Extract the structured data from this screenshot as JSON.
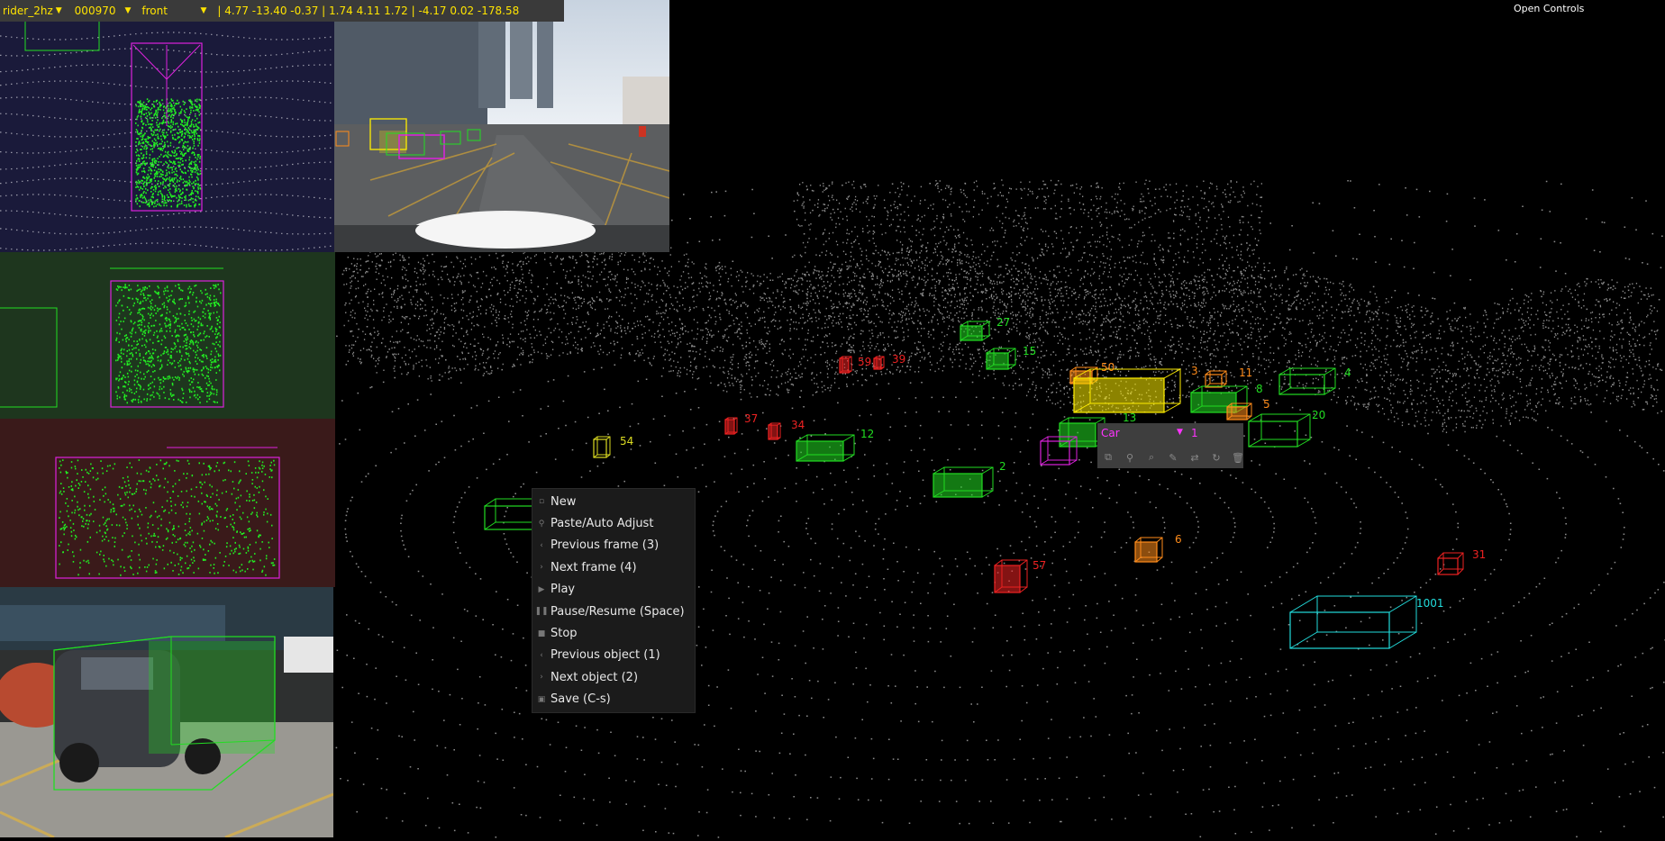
{
  "header": {
    "scene": "rider_2hz",
    "frame": "000970",
    "camera": "front",
    "position": "4.77 -13.40 -0.37",
    "scale": "1.74 4.11 1.72",
    "rotation": "-4.17 0.02 -178.58"
  },
  "open_controls": "Open Controls",
  "context_menu": [
    {
      "label": "New",
      "icon": "new-icon"
    },
    {
      "label": "Paste/Auto Adjust",
      "icon": "paste-icon"
    },
    {
      "label": "Previous frame (3)",
      "icon": "chevron-left-icon"
    },
    {
      "label": "Next frame (4)",
      "icon": "chevron-right-icon"
    },
    {
      "label": "Play",
      "icon": "play-icon"
    },
    {
      "label": "Pause/Resume (Space)",
      "icon": "pause-icon"
    },
    {
      "label": "Stop",
      "icon": "stop-icon"
    },
    {
      "label": "Previous object (1)",
      "icon": "chevron-left-icon"
    },
    {
      "label": "Next object (2)",
      "icon": "chevron-right-icon"
    },
    {
      "label": "Save (C-s)",
      "icon": "save-icon"
    }
  ],
  "object_toolbar": {
    "class": "Car",
    "id": "1",
    "tools": [
      "copy-icon",
      "pin-icon",
      "zoom-icon",
      "edit-icon",
      "swap-icon",
      "sync-icon",
      "delete-icon"
    ]
  },
  "labels": [
    {
      "text": "27",
      "color": "#22dd22"
    },
    {
      "text": "15",
      "color": "#22dd22"
    },
    {
      "text": "50",
      "color": "#ff8c1a"
    },
    {
      "text": "3",
      "color": "#ff8c1a"
    },
    {
      "text": "11",
      "color": "#ff8c1a"
    },
    {
      "text": "8",
      "color": "#22dd22"
    },
    {
      "text": "4",
      "color": "#22dd22"
    },
    {
      "text": "5",
      "color": "#ff8c1a"
    },
    {
      "text": "20",
      "color": "#22dd22"
    },
    {
      "text": "13",
      "color": "#22dd22"
    },
    {
      "text": "12",
      "color": "#22dd22"
    },
    {
      "text": "2",
      "color": "#22dd22"
    },
    {
      "text": "6",
      "color": "#ff8c1a"
    },
    {
      "text": "31",
      "color": "#ee2222"
    },
    {
      "text": "1001",
      "color": "#22dddd"
    },
    {
      "text": "59",
      "color": "#ee2222"
    },
    {
      "text": "39",
      "color": "#ee2222"
    },
    {
      "text": "54",
      "color": "#dddd22"
    },
    {
      "text": "37",
      "color": "#ee2222"
    },
    {
      "text": "34",
      "color": "#ee2222"
    },
    {
      "text": "57",
      "color": "#ee2222"
    }
  ],
  "colors": {
    "header_text": "#ffe400",
    "header_bg": "#3a3a3a",
    "selected": "#ff33ff",
    "car": "#22dd22",
    "truck": "#ffee00",
    "pedestrian": "#ee2222",
    "cyclist": "#ff8c1a",
    "bus": "#22dddd"
  }
}
